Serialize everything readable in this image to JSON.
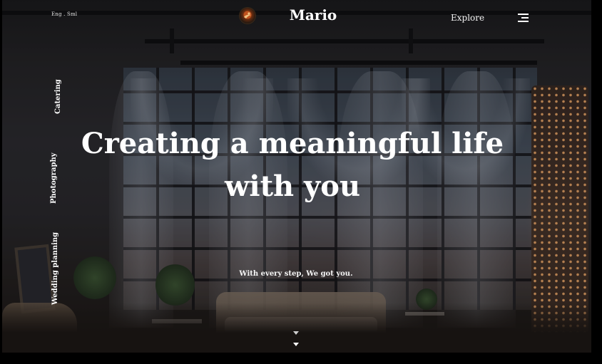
{
  "header": {
    "language_switch": "Eng . Sml",
    "brand": "Mario",
    "explore_label": "Explore",
    "logo_icon": "brand-logo-icon",
    "menu_icon": "hamburger-menu-icon"
  },
  "side_nav": {
    "items": [
      {
        "label": "Catering"
      },
      {
        "label": "Photography"
      },
      {
        "label": "Wedding planning"
      }
    ]
  },
  "hero": {
    "headline_line1": "Creating a meaningful life",
    "headline_line2": "with you",
    "tagline": "With every step, We got you.",
    "scroll_icon": "double-chevron-down-icon"
  },
  "colors": {
    "text": "#ffffff",
    "accent_logo": "#c0521e",
    "lights": "#ffb46e"
  }
}
